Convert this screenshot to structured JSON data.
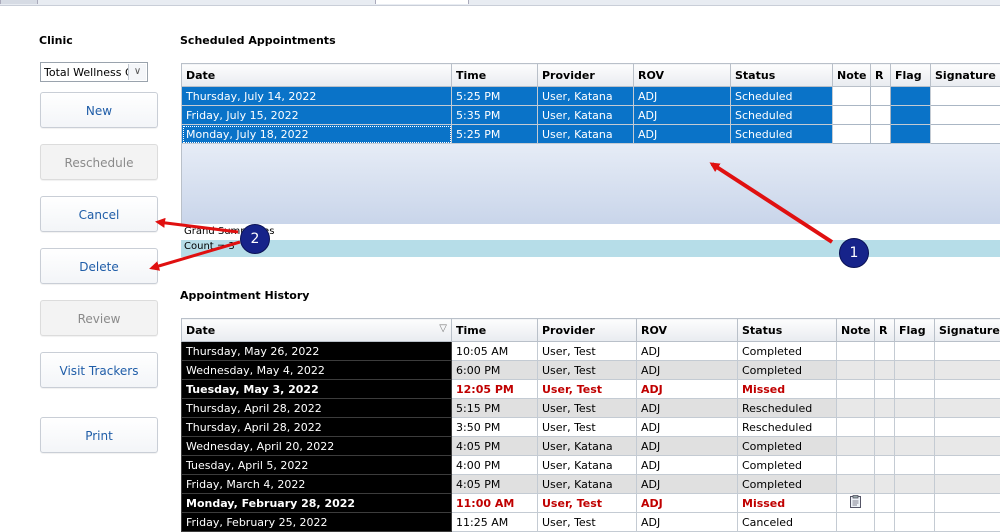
{
  "clinic": {
    "label": "Clinic",
    "selected": "Total Wellness C"
  },
  "buttons": {
    "new": "New",
    "reschedule": "Reschedule",
    "cancel": "Cancel",
    "delete": "Delete",
    "review": "Review",
    "visit_trackers": "Visit Trackers",
    "print": "Print"
  },
  "scheduled": {
    "title": "Scheduled Appointments",
    "columns": [
      "Date",
      "Time",
      "Provider",
      "ROV",
      "Status",
      "Note",
      "R",
      "Flag",
      "Signature"
    ],
    "rows": [
      {
        "date": "Thursday, July 14, 2022",
        "time": "5:25 PM",
        "provider": "User, Katana",
        "rov": "ADJ",
        "status": "Scheduled"
      },
      {
        "date": "Friday, July 15, 2022",
        "time": "5:35 PM",
        "provider": "User, Katana",
        "rov": "ADJ",
        "status": "Scheduled"
      },
      {
        "date": "Monday, July 18, 2022",
        "time": "5:25 PM",
        "provider": "User, Katana",
        "rov": "ADJ",
        "status": "Scheduled"
      }
    ],
    "grand_summaries": "Grand Summaries",
    "count": "Count = 3"
  },
  "history": {
    "title": "Appointment History",
    "columns": [
      "Date",
      "Time",
      "Provider",
      "ROV",
      "Status",
      "Note",
      "R",
      "Flag",
      "Signature"
    ],
    "sort_icon": "sort-desc-icon",
    "rows": [
      {
        "date": "Thursday, May 26, 2022",
        "time": "10:05 AM",
        "provider": "User, Test",
        "rov": "ADJ",
        "status": "Completed",
        "missed": false
      },
      {
        "date": "Wednesday, May 4, 2022",
        "time": "6:00 PM",
        "provider": "User, Test",
        "rov": "ADJ",
        "status": "Completed",
        "missed": false
      },
      {
        "date": "Tuesday, May 3, 2022",
        "time": "12:05 PM",
        "provider": "User, Test",
        "rov": "ADJ",
        "status": "Missed",
        "missed": true
      },
      {
        "date": "Thursday, April 28, 2022",
        "time": "5:15 PM",
        "provider": "User, Test",
        "rov": "ADJ",
        "status": "Rescheduled",
        "missed": false
      },
      {
        "date": "Thursday, April 28, 2022",
        "time": "3:50 PM",
        "provider": "User, Test",
        "rov": "ADJ",
        "status": "Rescheduled",
        "missed": false
      },
      {
        "date": "Wednesday, April 20, 2022",
        "time": "4:05 PM",
        "provider": "User, Katana",
        "rov": "ADJ",
        "status": "Completed",
        "missed": false
      },
      {
        "date": "Tuesday, April 5, 2022",
        "time": "4:00 PM",
        "provider": "User, Katana",
        "rov": "ADJ",
        "status": "Completed",
        "missed": false
      },
      {
        "date": "Friday, March 4, 2022",
        "time": "4:05 PM",
        "provider": "User, Katana",
        "rov": "ADJ",
        "status": "Completed",
        "missed": false
      },
      {
        "date": "Monday, February 28, 2022",
        "time": "11:00 AM",
        "provider": "User, Test",
        "rov": "ADJ",
        "status": "Missed",
        "missed": true,
        "note_icon": "clipboard-icon"
      },
      {
        "date": "Friday, February 25, 2022",
        "time": "11:25 AM",
        "provider": "User, Test",
        "rov": "ADJ",
        "status": "Canceled",
        "missed": false
      }
    ]
  },
  "annotations": {
    "badge1": "1",
    "badge2": "2",
    "arrow_color": "#e01010",
    "badge_color": "#16238a"
  },
  "colors": {
    "selected_row": "#0a73c8",
    "missed_text": "#c00000",
    "summary_bar": "#b6dde8"
  }
}
